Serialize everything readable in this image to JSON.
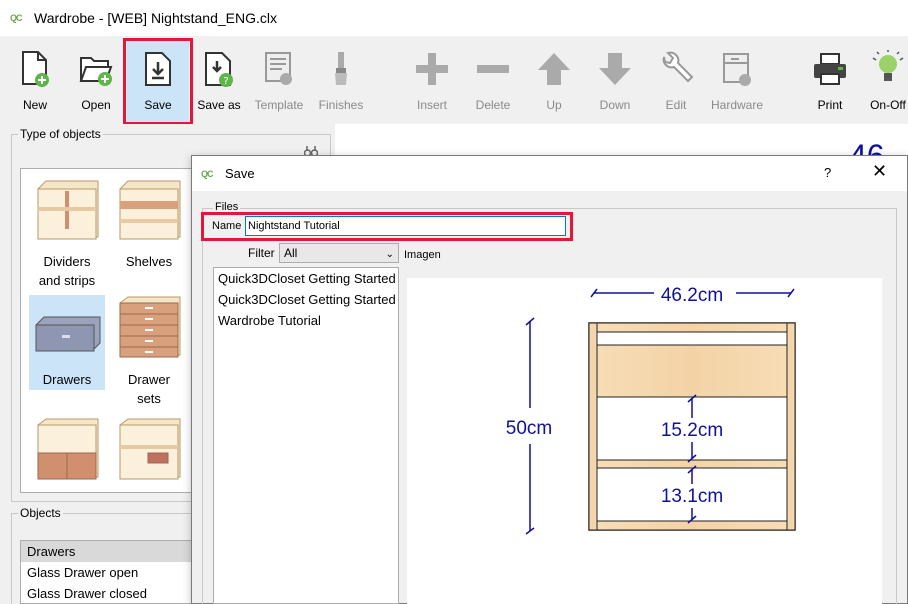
{
  "window": {
    "logo_text": "QC",
    "title": "Wardrobe - [WEB] Nightstand_ENG.clx"
  },
  "toolbar": {
    "buttons": [
      {
        "label": "New",
        "icon": "new-file-icon",
        "enabled": true
      },
      {
        "label": "Open",
        "icon": "open-folder-icon",
        "enabled": true
      },
      {
        "label": "Save",
        "icon": "save-icon",
        "enabled": true,
        "active": true
      },
      {
        "label": "Save as",
        "icon": "save-as-icon",
        "enabled": true
      },
      {
        "label": "Template",
        "icon": "template-icon",
        "enabled": false
      },
      {
        "label": "Finishes",
        "icon": "finishes-icon",
        "enabled": false
      },
      {
        "label": "Insert",
        "icon": "plus-icon",
        "enabled": false
      },
      {
        "label": "Delete",
        "icon": "minus-icon",
        "enabled": false
      },
      {
        "label": "Up",
        "icon": "arrow-up-icon",
        "enabled": false
      },
      {
        "label": "Down",
        "icon": "arrow-down-icon",
        "enabled": false
      },
      {
        "label": "Edit",
        "icon": "wrench-icon",
        "enabled": false
      },
      {
        "label": "Hardware",
        "icon": "hardware-icon",
        "enabled": false
      },
      {
        "label": "Print",
        "icon": "printer-icon",
        "enabled": true
      },
      {
        "label": "On-Off",
        "icon": "lightbulb-icon",
        "enabled": true
      }
    ]
  },
  "left_panel": {
    "type_of_objects_title": "Type of objects",
    "gallery": [
      {
        "line1": "Dividers",
        "line2": "and strips"
      },
      {
        "line1": "Shelves",
        "line2": ""
      },
      {
        "line1": "Drawers",
        "line2": "",
        "selected": true
      },
      {
        "line1": "Drawer",
        "line2": "sets"
      },
      {
        "line1": "",
        "line2": ""
      },
      {
        "line1": "",
        "line2": ""
      }
    ],
    "objects_title": "Objects",
    "objects": [
      "Drawers",
      "Glass Drawer open",
      "Glass Drawer closed"
    ],
    "selected_object": "Drawers"
  },
  "background_canvas": {
    "partial_text": "46"
  },
  "save_dialog": {
    "logo_text": "QC",
    "title": "Save",
    "help": "?",
    "close": "✕",
    "files_group_title": "Files",
    "name_label": "Name",
    "name_value": "Nightstand Tutorial",
    "filter_label": "Filter",
    "filter_value": "All",
    "imagen_label": "Imagen",
    "files": [
      "Quick3DCloset Getting Started",
      "Quick3DCloset Getting Started",
      "Wardrobe Tutorial"
    ],
    "preview": {
      "width_label": "46.2cm",
      "height_label": "50cm",
      "gap1_label": "15.2cm",
      "gap2_label": "13.1cm"
    }
  },
  "colors": {
    "highlight_red": "#e3173a",
    "dim_blue": "#1010a0",
    "wood": "#f4d8b0",
    "wood_edge": "#d9a97a",
    "selection": "#cce4f7"
  }
}
